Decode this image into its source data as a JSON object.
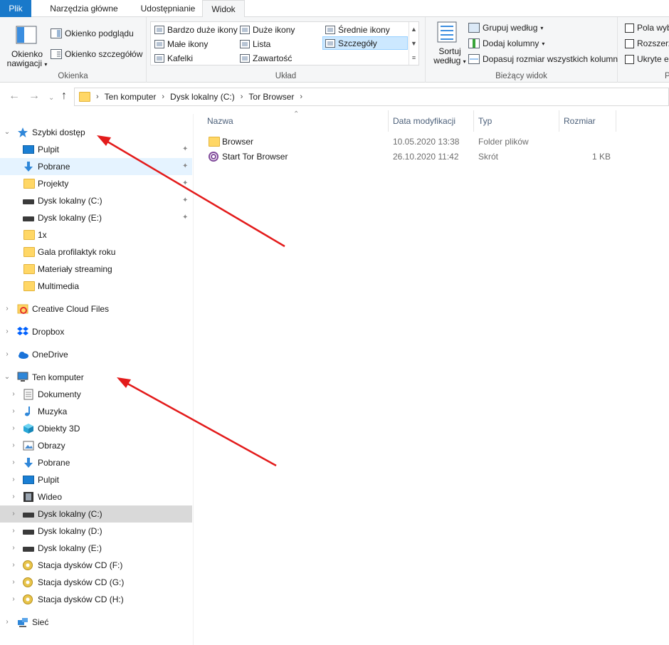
{
  "ribbon_tabs": [
    "Plik",
    "Narzędzia główne",
    "Udostępnianie",
    "Widok"
  ],
  "ribbon": {
    "okienka": {
      "label": "Okienka",
      "nav_pane_line1": "Okienko",
      "nav_pane_line2": "nawigacji",
      "preview": "Okienko podglądu",
      "details": "Okienko szczegółów"
    },
    "uklad": {
      "label": "Układ",
      "items": [
        "Bardzo duże ikony",
        "Duże ikony",
        "Średnie ikony",
        "Małe ikony",
        "Lista",
        "Szczegóły",
        "Kafelki",
        "Zawartość"
      ]
    },
    "biezacy_widok": {
      "label": "Bieżący widok",
      "sort_line1": "Sortuj",
      "sort_line2": "według",
      "group_by": "Grupuj według",
      "add_columns": "Dodaj kolumny",
      "fit_columns": "Dopasuj rozmiar wszystkich kolumn"
    },
    "pokaz": {
      "label": "P",
      "checkboxes": [
        "Pola wyb",
        "Rozszerza",
        "Ukryte e"
      ]
    }
  },
  "address": {
    "crumbs": [
      "Ten komputer",
      "Dysk lokalny (C:)",
      "Tor Browser"
    ]
  },
  "nav": {
    "quick_access": "Szybki dostęp",
    "quick_items": [
      "Pulpit",
      "Pobrane",
      "Projekty",
      "Dysk lokalny (C:)",
      "Dysk lokalny (E:)",
      "1x",
      "Gala profilaktyk roku",
      "Materiały streaming",
      "Multimedia"
    ],
    "creative_cloud": "Creative Cloud Files",
    "dropbox": "Dropbox",
    "onedrive": "OneDrive",
    "this_pc": "Ten komputer",
    "pc_items": [
      "Dokumenty",
      "Muzyka",
      "Obiekty 3D",
      "Obrazy",
      "Pobrane",
      "Pulpit",
      "Wideo",
      "Dysk lokalny (C:)",
      "Dysk lokalny (D:)",
      "Dysk lokalny (E:)",
      "Stacja dysków CD (F:)",
      "Stacja dysków CD (G:)",
      "Stacja dysków CD (H:)"
    ],
    "network": "Sieć"
  },
  "columns": [
    "Nazwa",
    "Data modyfikacji",
    "Typ",
    "Rozmiar"
  ],
  "files": [
    {
      "name": "Browser",
      "date": "10.05.2020 13:38",
      "type": "Folder plików",
      "size": ""
    },
    {
      "name": "Start Tor Browser",
      "date": "26.10.2020 11:42",
      "type": "Skrót",
      "size": "1 KB"
    }
  ],
  "colors": {
    "file_tab": "#1979ca",
    "selection": "#cce8ff",
    "annotation_arrow": "#e31b1b"
  }
}
